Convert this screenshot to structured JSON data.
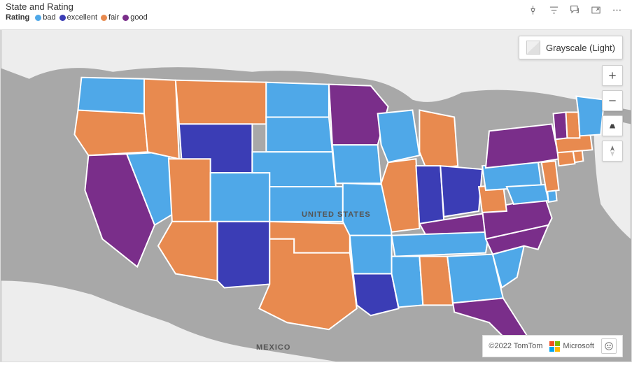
{
  "header": {
    "title": "State and Rating",
    "legend_label": "Rating",
    "legend": [
      {
        "label": "bad",
        "color": "#4FA8E8"
      },
      {
        "label": "excellent",
        "color": "#3B3DB5"
      },
      {
        "label": "fair",
        "color": "#E88A4F"
      },
      {
        "label": "good",
        "color": "#7A2E8A"
      }
    ]
  },
  "basemap": {
    "label": "Grayscale (Light)"
  },
  "map_labels": {
    "country": "UNITED STATES",
    "neighbor": "MEXICO"
  },
  "attribution": {
    "tomtom": "©2022 TomTom",
    "microsoft": "Microsoft"
  },
  "colors": {
    "bad": "#4FA8E8",
    "excellent": "#3B3DB5",
    "fair": "#E88A4F",
    "good": "#7A2E8A",
    "land": "#EDEDED",
    "water": "#A8A8A8",
    "stroke": "#FFFFFF"
  },
  "chart_data": {
    "type": "choropleth-map",
    "title": "State and Rating",
    "categories": [
      "bad",
      "excellent",
      "fair",
      "good"
    ],
    "states": [
      {
        "state": "Washington",
        "rating": "bad"
      },
      {
        "state": "Oregon",
        "rating": "fair"
      },
      {
        "state": "California",
        "rating": "good"
      },
      {
        "state": "Idaho",
        "rating": "fair"
      },
      {
        "state": "Nevada",
        "rating": "bad"
      },
      {
        "state": "Montana",
        "rating": "fair"
      },
      {
        "state": "Wyoming",
        "rating": "excellent"
      },
      {
        "state": "Utah",
        "rating": "fair"
      },
      {
        "state": "Arizona",
        "rating": "fair"
      },
      {
        "state": "Colorado",
        "rating": "bad"
      },
      {
        "state": "New Mexico",
        "rating": "excellent"
      },
      {
        "state": "North Dakota",
        "rating": "bad"
      },
      {
        "state": "South Dakota",
        "rating": "bad"
      },
      {
        "state": "Nebraska",
        "rating": "bad"
      },
      {
        "state": "Kansas",
        "rating": "bad"
      },
      {
        "state": "Oklahoma",
        "rating": "fair"
      },
      {
        "state": "Texas",
        "rating": "fair"
      },
      {
        "state": "Minnesota",
        "rating": "good"
      },
      {
        "state": "Iowa",
        "rating": "bad"
      },
      {
        "state": "Missouri",
        "rating": "bad"
      },
      {
        "state": "Arkansas",
        "rating": "bad"
      },
      {
        "state": "Louisiana",
        "rating": "excellent"
      },
      {
        "state": "Wisconsin",
        "rating": "bad"
      },
      {
        "state": "Illinois",
        "rating": "fair"
      },
      {
        "state": "Michigan",
        "rating": "fair"
      },
      {
        "state": "Indiana",
        "rating": "excellent"
      },
      {
        "state": "Ohio",
        "rating": "excellent"
      },
      {
        "state": "Kentucky",
        "rating": "good"
      },
      {
        "state": "Tennessee",
        "rating": "bad"
      },
      {
        "state": "Mississippi",
        "rating": "bad"
      },
      {
        "state": "Alabama",
        "rating": "fair"
      },
      {
        "state": "Georgia",
        "rating": "bad"
      },
      {
        "state": "Florida",
        "rating": "good"
      },
      {
        "state": "South Carolina",
        "rating": "bad"
      },
      {
        "state": "North Carolina",
        "rating": "good"
      },
      {
        "state": "Virginia",
        "rating": "good"
      },
      {
        "state": "West Virginia",
        "rating": "fair"
      },
      {
        "state": "Maryland",
        "rating": "bad"
      },
      {
        "state": "Delaware",
        "rating": "bad"
      },
      {
        "state": "Pennsylvania",
        "rating": "bad"
      },
      {
        "state": "New Jersey",
        "rating": "fair"
      },
      {
        "state": "New York",
        "rating": "good"
      },
      {
        "state": "Connecticut",
        "rating": "fair"
      },
      {
        "state": "Rhode Island",
        "rating": "fair"
      },
      {
        "state": "Massachusetts",
        "rating": "fair"
      },
      {
        "state": "Vermont",
        "rating": "good"
      },
      {
        "state": "New Hampshire",
        "rating": "fair"
      },
      {
        "state": "Maine",
        "rating": "bad"
      }
    ]
  }
}
